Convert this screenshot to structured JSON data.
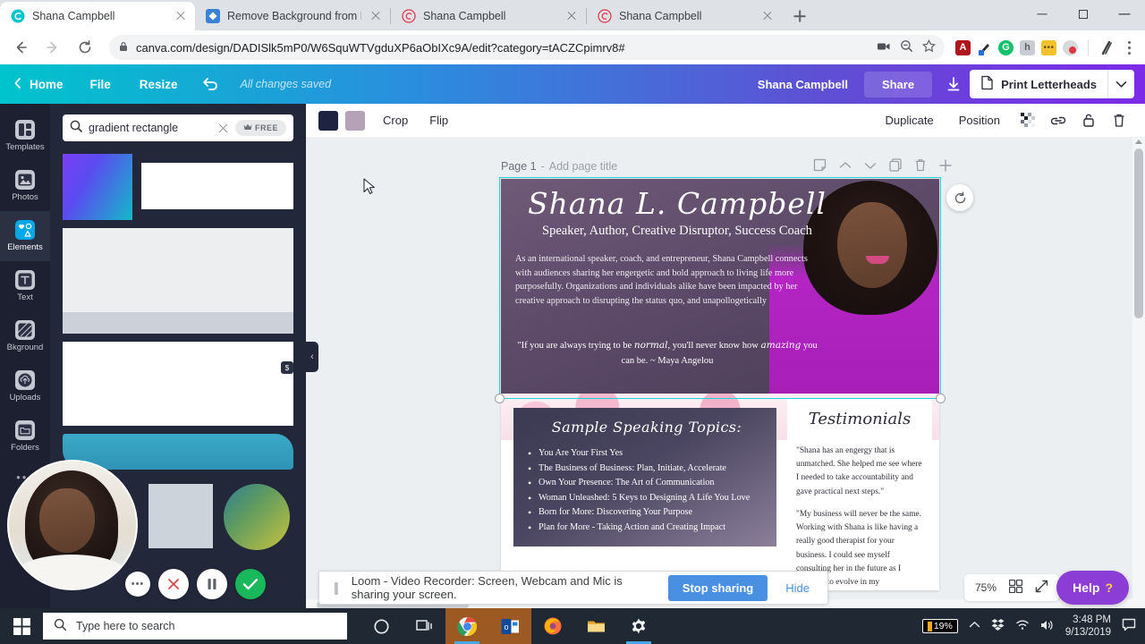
{
  "browser": {
    "tabs": [
      {
        "title": "Shana Campbell",
        "favicon": "canva-icon",
        "active": true
      },
      {
        "title": "Remove Background from Image",
        "favicon": "blue-diamond-icon",
        "active": false
      },
      {
        "title": "Shana Campbell",
        "favicon": "red-spiral-icon",
        "active": false
      },
      {
        "title": "Shana Campbell",
        "favicon": "red-spiral-icon",
        "active": false
      }
    ],
    "new_tab_label": "+",
    "window_controls": {
      "minimize": "–",
      "maximize": "❐",
      "close": "✕"
    },
    "address": {
      "host": "canva.com",
      "path": "/design/DADISlk5mP0/W6SquWTVgduXP6aObIXc9A/edit?category=tACZCpimrv8#",
      "full": "canva.com/design/DADISlk5mP0/W6SquWTVgduXP6aObIXc9A/edit?category=tACZCpimrv8#",
      "lock_icon": "padlock-icon"
    },
    "toolbar_icons": [
      "camera-icon",
      "zoom-out-icon",
      "star-icon",
      "adobe-acrobat-extension",
      "pen-extension",
      "grammarly-extension",
      "honey-extension",
      "yellow-dots-extension",
      "red-circle-extension",
      "slash-extension",
      "kebab-menu"
    ]
  },
  "canva_top": {
    "home": "Home",
    "menu": [
      "File",
      "Resize"
    ],
    "undo_icon": "undo-arrow-icon",
    "save_status": "All changes saved",
    "user": "Shana Campbell",
    "share": "Share",
    "download_icon": "download-icon",
    "doc_type": "Print Letterheads",
    "doc_icon": "document-icon",
    "caret": "˅"
  },
  "rail": {
    "items": [
      {
        "label": "Templates",
        "icon": "templates-icon",
        "active": false
      },
      {
        "label": "Photos",
        "icon": "photos-icon",
        "active": false
      },
      {
        "label": "Elements",
        "icon": "elements-icon",
        "active": true
      },
      {
        "label": "Text",
        "icon": "text-icon",
        "active": false
      },
      {
        "label": "Bkground",
        "icon": "background-icon",
        "active": false
      },
      {
        "label": "Uploads",
        "icon": "uploads-icon",
        "active": false
      },
      {
        "label": "Folders",
        "icon": "folders-icon",
        "active": false
      }
    ],
    "more": "•••"
  },
  "panel": {
    "search_value": "gradient rectangle",
    "search_placeholder": "Search elements",
    "search_icon": "search-icon",
    "clear_icon": "clear-x-icon",
    "free_badge": "FREE",
    "crown_icon": "crown-icon",
    "price_badge": "$",
    "collapse_icon": "chevron-left-icon"
  },
  "editbar": {
    "swatches": [
      "#1f2342",
      "#b6a2b8"
    ],
    "crop": "Crop",
    "flip": "Flip",
    "duplicate": "Duplicate",
    "position": "Position",
    "transparency_icon": "transparency-icon",
    "link_icon": "link-icon",
    "lock_icon": "lock-icon",
    "delete_icon": "trash-icon"
  },
  "page": {
    "label": "Page 1",
    "separator": "-",
    "add_title": "Add page title",
    "icons": [
      "notes-icon",
      "move-up-icon",
      "move-down-icon",
      "duplicate-page-icon",
      "delete-page-icon",
      "add-page-icon"
    ],
    "rotate_icon": "rotate-icon"
  },
  "design": {
    "name": "Shana L. Campbell",
    "tagline": "Speaker, Author, Creative Disruptor, Success Coach",
    "bio": "As an international speaker, coach, and entrepreneur, Shana Campbell connects with audiences sharing her engergetic and  bold approach to living life more purposefully.  Organizations and individuals alike have been impacted by her creative approach to disrupting the status quo, and unapollogetically",
    "quote_part1": "\"If you are always trying to be ",
    "quote_em1": "normal",
    "quote_part2": ", you'll never know how ",
    "quote_em2": "amazing",
    "quote_part3": " you can be. ~ Maya Angelou",
    "topics_title": "Sample Speaking Topics:",
    "topics": [
      "You Are Your First Yes",
      "The Business of Business:  Plan, Initiate, Accelerate",
      "Own Your Presence: The Art of Communication",
      "Woman Unleashed: 5 Keys to Designing  A Life You Love",
      "Born for More: Discovering Your Purpose",
      "Plan for More - Taking Action and Creating Impact"
    ],
    "testimonials_title": "Testimonials",
    "testimonials": [
      "\"Shana has an engergy that is unmatched. She helped me see where I needed to take accountability and gave practical next steps.\"",
      "\"My business will never be the same. Working with Shana is like having a really good therapist for your business. I could see myself consulting her in the future as I continue to evolve in my"
    ]
  },
  "footer": {
    "zoom": "75%",
    "grid_icon": "grid-view-icon",
    "fullscreen_icon": "expand-icon",
    "help": "Help",
    "help_mark": "?"
  },
  "sharebar": {
    "grip_icon": "drag-grip-icon",
    "message": "Loom - Video Recorder: Screen, Webcam and Mic is sharing your screen.",
    "stop": "Stop sharing",
    "hide": "Hide"
  },
  "webcam_controls": {
    "more": "•••",
    "cancel_icon": "close-x-icon",
    "pause_icon": "pause-icon",
    "done_icon": "check-icon"
  },
  "taskbar": {
    "start_icon": "windows-start-icon",
    "search_placeholder": "Type here to search",
    "search_icon": "search-icon",
    "apps": [
      "cortana-icon",
      "task-view-icon",
      "chrome-icon",
      "outlook-icon",
      "firefox-icon",
      "file-explorer-icon",
      "settings-icon"
    ],
    "tray": {
      "battery": "19%",
      "chevron_icon": "show-hidden-icons",
      "dropbox_icon": "dropbox-icon",
      "wifi_icon": "wifi-icon",
      "volume_icon": "volume-icon",
      "time": "3:48 PM",
      "date": "9/13/2019",
      "notification_icon": "notifications-icon"
    }
  },
  "colors": {
    "canva_gradient_start": "#00c4cc",
    "canva_gradient_end": "#7d2ae8",
    "accent_blue": "#4a90e2",
    "help_purple": "#8b3dd6",
    "selection_cyan": "#18d4d4"
  }
}
